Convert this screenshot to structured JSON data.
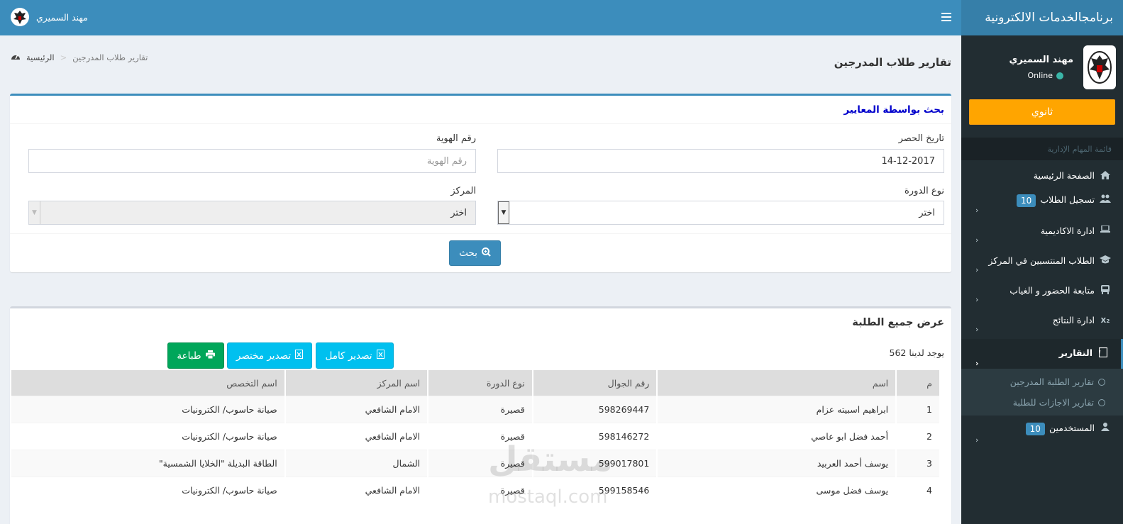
{
  "sidebar": {
    "brand": "برنامجالخدمات الالكترونية",
    "user_name": "مهند السميري",
    "status": "Online",
    "level_button": "ثانوي",
    "menu_header": "قائمة المهام الإدارية",
    "items": [
      {
        "label": "الصفحة الرئيسية",
        "icon": "home-icon"
      },
      {
        "label": "تسجيل الطلاب",
        "badge": "10",
        "icon": "users-icon"
      },
      {
        "label": "ادارة الاكاديمية",
        "icon": "laptop-icon"
      },
      {
        "label": "الطلاب المنتسبين في المركز",
        "icon": "graduation-cap-icon"
      },
      {
        "label": "متابعة الحضور و الغياب",
        "icon": "bus-icon"
      },
      {
        "label": "ادارة النتائج",
        "icon": "subscript-icon"
      },
      {
        "label": "التقارير",
        "icon": "file-word-icon"
      },
      {
        "label": "المستخدمين",
        "badge": "10",
        "icon": "user-icon"
      }
    ],
    "submenu": [
      "تقارير الطلبة المدرجين",
      "تقارير الاجازات للطلبة"
    ]
  },
  "navbar": {
    "user_name": "مهند السميري"
  },
  "breadcrumb": {
    "home": "الرئيسية",
    "current": "تقارير طلاب المدرجين"
  },
  "page_title": "تقارير طلاب المدرجين",
  "search_box": {
    "title": "بحث بواسطة المعايير",
    "date_label": "تاريخ الحصر",
    "date_value": "14-12-2017",
    "id_label": "رقم الهوية",
    "id_placeholder": "رقم الهوية",
    "course_label": "نوع الدورة",
    "course_value": "اختر",
    "center_label": "المركز",
    "center_value": "اختر",
    "search_button": "بحث"
  },
  "results_box": {
    "title": "عرض جميع الطلبة",
    "count": "يوجد لدينا 562",
    "export_full": "تصدير كامل",
    "export_short": "تصدير مختصر",
    "print": "طباعة",
    "columns": [
      "م",
      "اسم",
      "رقم الجوال",
      "نوع الدورة",
      "اسم المركز",
      "اسم التخصص"
    ],
    "rows": [
      [
        "1",
        "ابراهيم اسبيته عزام",
        "598269447",
        "قصيرة",
        "الامام الشافعي",
        "صيانة حاسوب/ الكترونيات"
      ],
      [
        "2",
        "أحمد فضل ابو عاصي",
        "598146272",
        "قصيرة",
        "الامام الشافعي",
        "صيانة حاسوب/ الكترونيات"
      ],
      [
        "3",
        "يوسف أحمد العربيد",
        "599017801",
        "قصيرة",
        "الشمال",
        "الطاقة البديلة \"الخلايا الشمسية\""
      ],
      [
        "4",
        "يوسف فضل موسى",
        "599158546",
        "قصيرة",
        "الامام الشافعي",
        "صيانة حاسوب/ الكترونيات"
      ]
    ]
  },
  "watermark": {
    "text": "مستقل",
    "sub": "mostaql.com"
  },
  "colors": {
    "sidebar": "#222d32",
    "navbar": "#3c8dbc",
    "accent": "#ffa500",
    "success": "#00a65a",
    "info": "#00c0ef"
  }
}
